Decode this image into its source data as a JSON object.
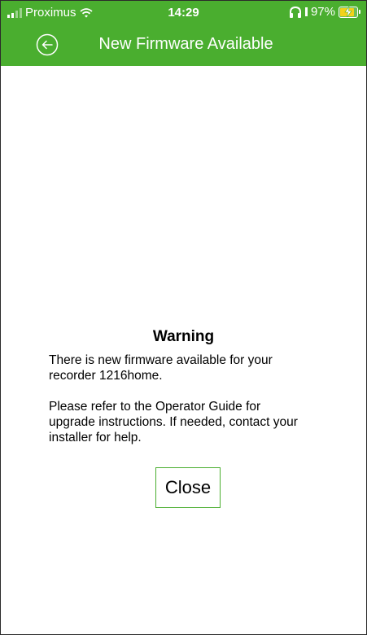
{
  "status_bar": {
    "carrier": "Proximus",
    "time": "14:29",
    "battery": "97%",
    "battery_level": 0.97
  },
  "header": {
    "title": "New Firmware Available",
    "back_icon": "circle-left-arrow-icon",
    "background_color": "#4aae2f"
  },
  "dialog": {
    "heading": "Warning",
    "message_1": "There is new firmware available for your\nrecorder  1216home.",
    "message_2": "Please refer to the Operator Guide for\nupgrade instructions. If needed, contact your\ninstaller for help.",
    "close_label": "Close",
    "button_border_color": "#4aae2f"
  }
}
